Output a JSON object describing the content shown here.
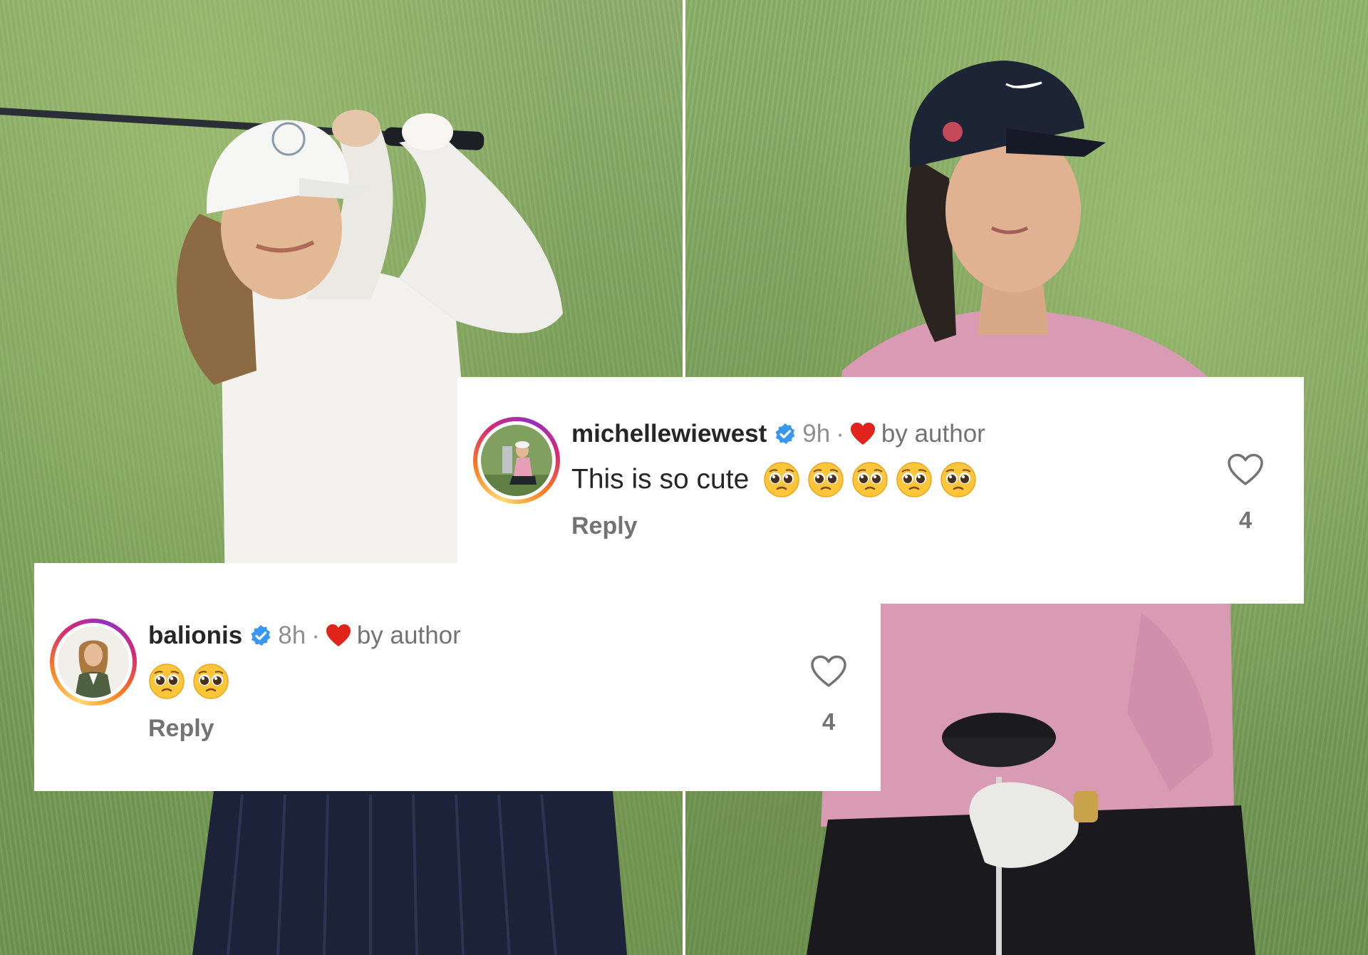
{
  "comments": [
    {
      "username": "michellewiewest",
      "verified": true,
      "time": "9h",
      "separator": "·",
      "liked_by_author_label": "by author",
      "text": "This is so cute",
      "emojis": [
        "pleading-face",
        "pleading-face",
        "pleading-face",
        "pleading-face",
        "pleading-face"
      ],
      "reply_label": "Reply",
      "like_count": "4"
    },
    {
      "username": "balionis",
      "verified": true,
      "time": "8h",
      "separator": "·",
      "liked_by_author_label": "by author",
      "text": "",
      "emojis": [
        "pleading-face",
        "pleading-face"
      ],
      "reply_label": "Reply",
      "like_count": "4"
    }
  ],
  "colors": {
    "verified_badge": "#3897f0",
    "liked_heart": "#e0241b",
    "username": "#262626",
    "secondary_text": "#737373",
    "card_background": "#ffffff"
  },
  "icons": {
    "verified": "verified-badge-icon",
    "author_heart": "heart-filled-icon",
    "like": "heart-outline-icon",
    "emoji": "pleading-face-emoji"
  }
}
